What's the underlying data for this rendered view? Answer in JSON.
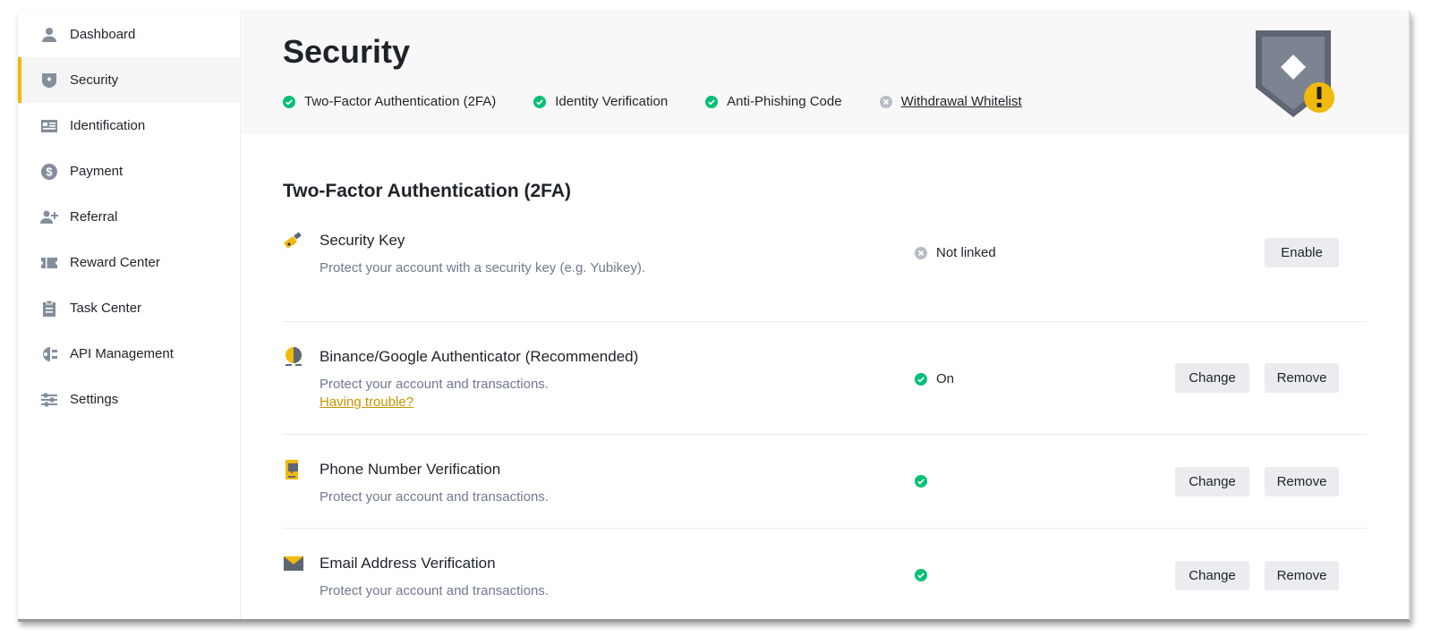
{
  "sidebar": {
    "items": [
      {
        "label": "Dashboard",
        "icon": "user-icon"
      },
      {
        "label": "Security",
        "icon": "shield-icon",
        "active": true
      },
      {
        "label": "Identification",
        "icon": "id-card-icon"
      },
      {
        "label": "Payment",
        "icon": "dollar-icon"
      },
      {
        "label": "Referral",
        "icon": "add-user-icon"
      },
      {
        "label": "Reward Center",
        "icon": "ticket-icon"
      },
      {
        "label": "Task Center",
        "icon": "clipboard-icon"
      },
      {
        "label": "API Management",
        "icon": "api-icon"
      },
      {
        "label": "Settings",
        "icon": "sliders-icon"
      }
    ]
  },
  "header": {
    "title": "Security",
    "statuses": [
      {
        "label": "Two-Factor Authentication (2FA)",
        "state": "done"
      },
      {
        "label": "Identity Verification",
        "state": "done"
      },
      {
        "label": "Anti-Phishing Code",
        "state": "done"
      },
      {
        "label": "Withdrawal Whitelist",
        "state": "not-done"
      }
    ]
  },
  "twofa": {
    "section_title": "Two-Factor Authentication (2FA)",
    "items": [
      {
        "title": "Security Key",
        "desc": "Protect your account with a security key (e.g. Yubikey).",
        "status": "Not linked",
        "status_state": "off",
        "buttons": [
          "Enable"
        ],
        "icon": "usb-key-icon"
      },
      {
        "title": "Binance/Google Authenticator (Recommended)",
        "desc": "Protect your account and transactions.",
        "link": "Having trouble?",
        "status": "On",
        "status_state": "on",
        "buttons": [
          "Change",
          "Remove"
        ],
        "icon": "authenticator-icon"
      },
      {
        "title": "Phone Number Verification",
        "desc": "Protect your account and transactions.",
        "status": "",
        "status_state": "on",
        "buttons": [
          "Change",
          "Remove"
        ],
        "icon": "phone-icon"
      },
      {
        "title": "Email Address Verification",
        "desc": "Protect your account and transactions.",
        "status": "",
        "status_state": "on",
        "buttons": [
          "Change",
          "Remove"
        ],
        "icon": "envelope-icon"
      }
    ]
  },
  "colors": {
    "accent": "#f0b90b",
    "success": "#02c076",
    "muted": "#b7bdc6",
    "link": "#c99400"
  }
}
